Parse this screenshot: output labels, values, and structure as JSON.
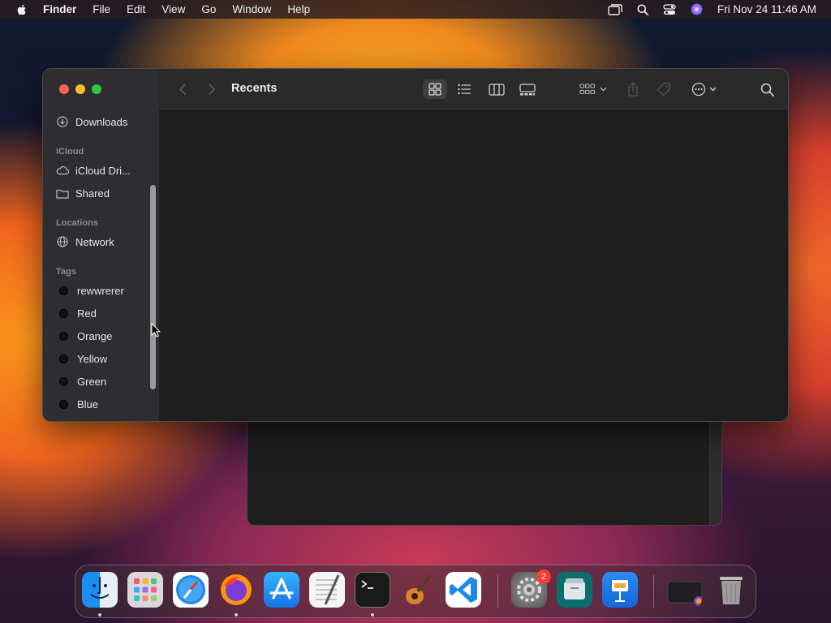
{
  "menubar": {
    "app_name": "Finder",
    "menus": [
      "File",
      "Edit",
      "View",
      "Go",
      "Window",
      "Help"
    ],
    "clock": "Fri Nov 24  11:46 AM",
    "icons": [
      "apple-icon",
      "screen-mirroring-icon",
      "spotlight-search-icon",
      "control-center-icon",
      "siri-icon"
    ]
  },
  "finder": {
    "title": "Recents",
    "sidebar": {
      "favorites": [
        {
          "label": "Downloads",
          "icon": "downloads-icon"
        }
      ],
      "icloud_header": "iCloud",
      "icloud": [
        {
          "label": "iCloud Dri...",
          "icon": "icloud-icon"
        },
        {
          "label": "Shared",
          "icon": "shared-folder-icon"
        }
      ],
      "locations_header": "Locations",
      "locations": [
        {
          "label": "Network",
          "icon": "network-icon"
        }
      ],
      "tags_header": "Tags",
      "tags": [
        {
          "label": "rewwrerer"
        },
        {
          "label": "Red"
        },
        {
          "label": "Orange"
        },
        {
          "label": "Yellow"
        },
        {
          "label": "Green"
        },
        {
          "label": "Blue"
        }
      ]
    },
    "toolbar_icons": [
      "back-icon",
      "forward-icon",
      "icon-view-icon",
      "list-view-icon",
      "column-view-icon",
      "gallery-view-icon",
      "group-icon",
      "share-icon",
      "tag-icon",
      "more-actions-icon",
      "search-icon"
    ],
    "active_view": "icon-view"
  },
  "dock": {
    "apps": [
      "Finder",
      "Launchpad",
      "Safari",
      "Firefox",
      "App Store",
      "TextEdit",
      "Terminal",
      "GarageBand",
      "Visual Studio Code",
      "System Settings",
      "Archive Utility",
      "Keynote",
      "Downloads",
      "Trash"
    ],
    "system_settings_badge": "2"
  },
  "colors": {
    "close": "#fe5f57",
    "minimize": "#febc2e",
    "zoom": "#28c840",
    "badge": "#ff3b30"
  }
}
